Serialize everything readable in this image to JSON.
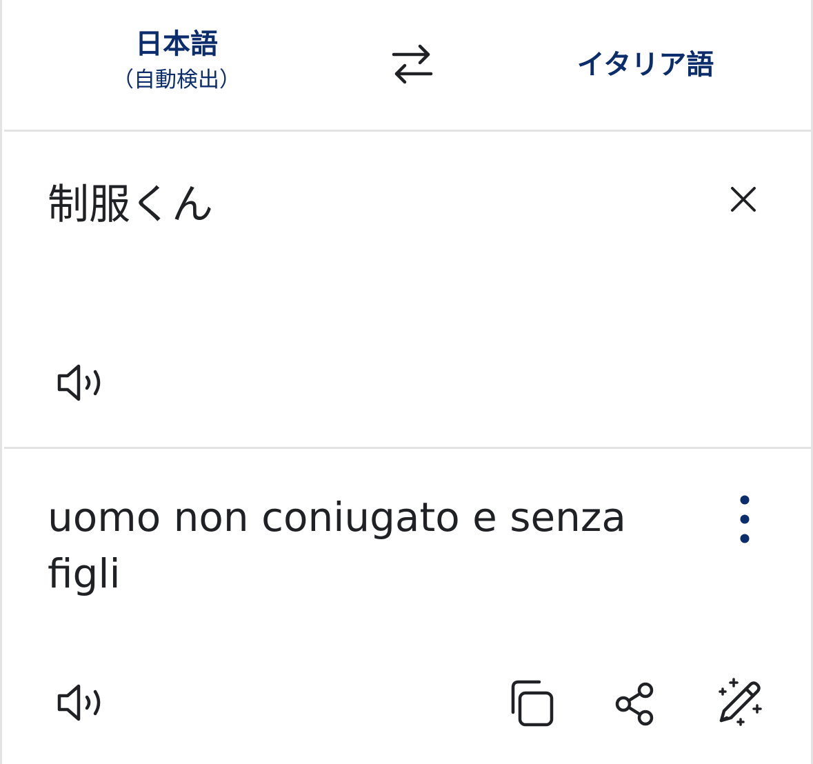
{
  "language_bar": {
    "source_language": "日本語",
    "source_note": "（自動検出）",
    "target_language": "イタリア語",
    "swap_icon": "swap-arrows-icon"
  },
  "source": {
    "text": "制服くん",
    "clear_icon": "close-icon",
    "speak_icon": "speaker-icon"
  },
  "target": {
    "text": "uomo non coniugato e senza figli",
    "more_icon": "more-vertical-icon",
    "speak_icon": "speaker-icon",
    "copy_icon": "copy-icon",
    "share_icon": "share-icon",
    "refine_icon": "magic-pen-icon"
  },
  "colors": {
    "accent": "#0b2d6b",
    "text": "#202124",
    "divider": "#e3e3e3"
  }
}
